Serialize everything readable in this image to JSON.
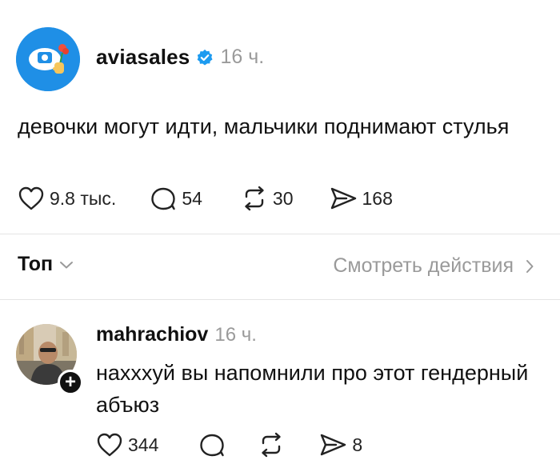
{
  "post": {
    "username": "aviasales",
    "time": "16 ч.",
    "text": "девочки могут идти, мальчики поднимают стулья",
    "likes": "9.8 тыс.",
    "comments": "54",
    "reposts": "30",
    "shares": "168"
  },
  "sort": {
    "label": "Топ"
  },
  "activity": {
    "label": "Смотреть действия"
  },
  "comment": {
    "username": "mahrachiov",
    "time": "16 ч.",
    "text": "нахххуй вы напомнили про этот гендерный абъюз",
    "likes": "344",
    "shares": "8"
  },
  "colors": {
    "brand": "#1f8fe6",
    "verified": "#1d9bf0",
    "muted": "#9a9a9a"
  }
}
